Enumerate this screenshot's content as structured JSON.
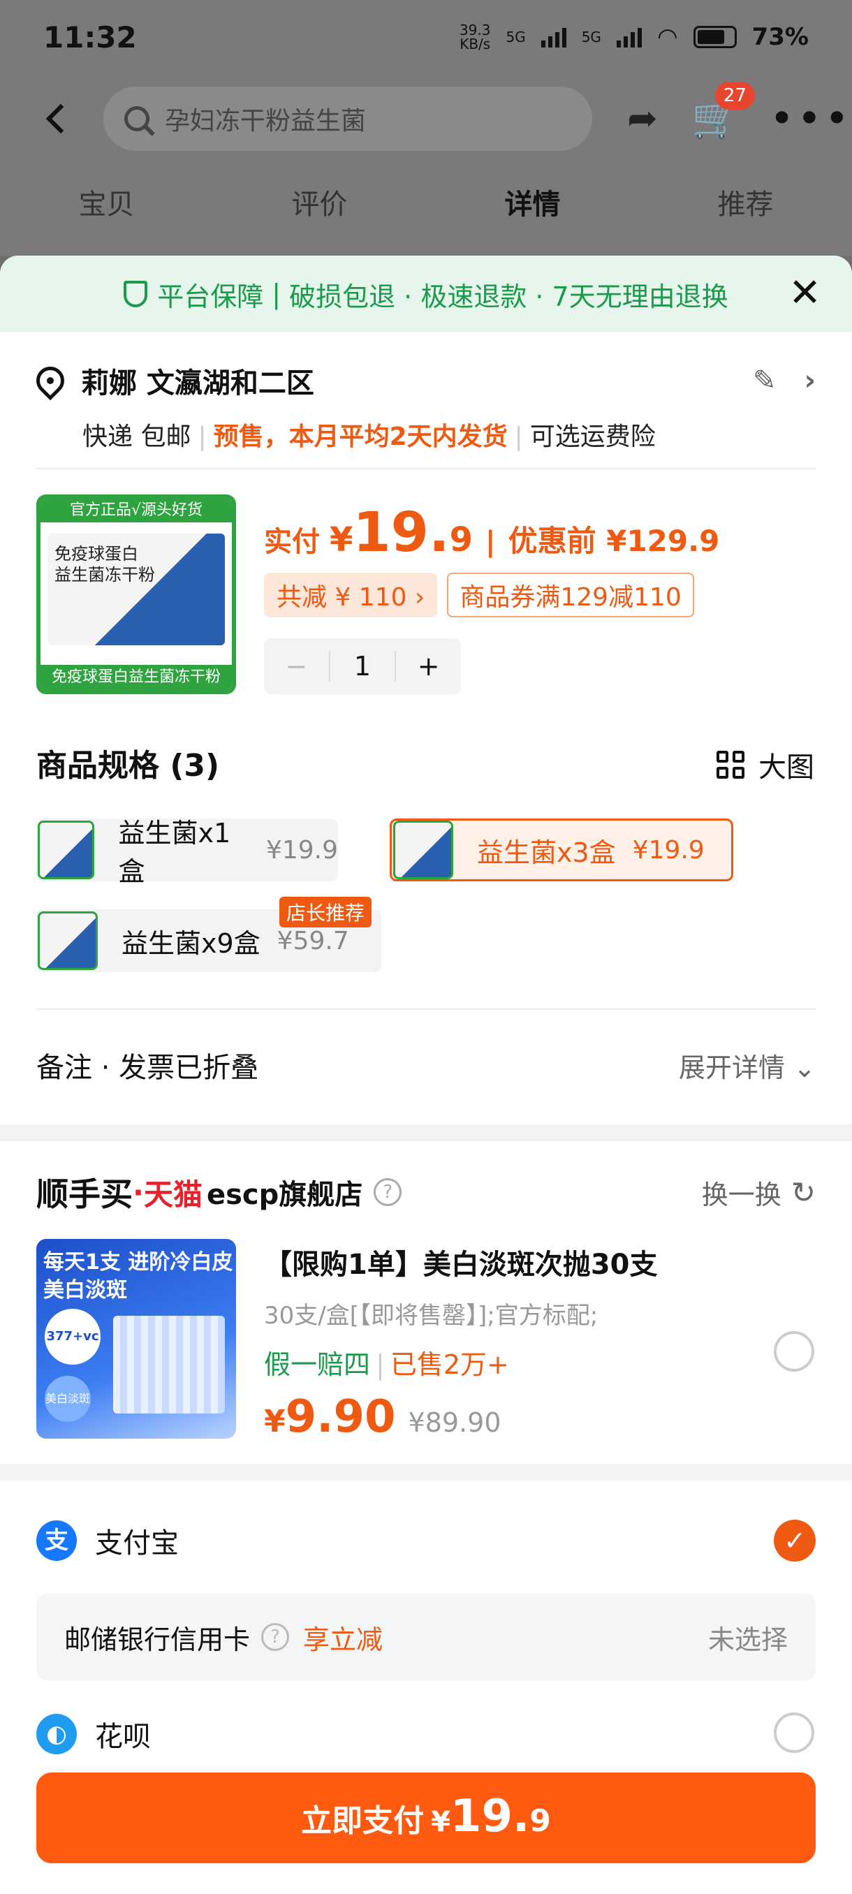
{
  "status_bar": {
    "time": "11:32",
    "speed": "39.3\nKB/s",
    "net1": "5G",
    "net2": "5G",
    "battery": "73%"
  },
  "header": {
    "search_placeholder": "孕妇冻干粉益生菌",
    "cart_count": "27"
  },
  "tabs": [
    "宝贝",
    "评价",
    "详情",
    "推荐"
  ],
  "guarantee": {
    "label": "平台保障",
    "items": "破损包退 · 极速退款 · 7天无理由退换"
  },
  "address": {
    "name_line": "莉娜 文瀛湖和二区",
    "shipping": "快递 包邮",
    "presale": "预售，本月平均2天内发货",
    "insurance": "可选运费险"
  },
  "product": {
    "tag_top": "官方正品√源头好货",
    "box_text1": "免疫球蛋白",
    "box_text2": "益生菌冻干粉",
    "tag_bottom": "免疫球蛋白益生菌冻干粉",
    "pay_label": "实付",
    "yen": "¥",
    "price_int": "19.",
    "price_dec": "9",
    "before_label": "优惠前 ¥129.9",
    "discount_chip": "共减 ¥ 110 ›",
    "coupon_chip": "商品券满129减110",
    "quantity": "1"
  },
  "specs": {
    "title": "商品规格 (3)",
    "big_view": "大图",
    "items": [
      {
        "name": "益生菌x1盒",
        "price": "¥19.9"
      },
      {
        "name": "益生菌x3盒",
        "price": "¥19.9"
      },
      {
        "name": "益生菌x9盒",
        "price": "¥59.7"
      }
    ],
    "sticker": "店长推荐"
  },
  "notes": {
    "label": "备注 · 发票已折叠",
    "expand": "展开详情"
  },
  "recommend": {
    "brand_prefix": "顺手买",
    "dot": "·",
    "tmall": "天猫",
    "store": "escp旗舰店",
    "swap": "换一换",
    "img_t1": "每天1支 进阶冷白皮",
    "img_t2": "美白淡斑",
    "img_circle": "377+vc",
    "img_circle2": "美白淡斑",
    "title": "【限购1单】美白淡斑次抛30支",
    "sub": "30支/盒[【即将售罄】];官方标配;",
    "tag_green": "假一赔四",
    "tag_orange": "已售2万+",
    "yen": "¥",
    "price": "9.90",
    "old_price": "¥89.90"
  },
  "payment": {
    "alipay": "支付宝",
    "bank": "邮储银行信用卡",
    "bank_discount": "享立减",
    "bank_state": "未选择",
    "huabei": "花呗",
    "pay_button": "立即支付",
    "pay_yen": "¥",
    "pay_int": "19.",
    "pay_dec": "9"
  },
  "colors": {
    "accent": "#ee5a12",
    "pay_button": "#ff5a10",
    "guarantee_green": "#1a9a4a"
  }
}
